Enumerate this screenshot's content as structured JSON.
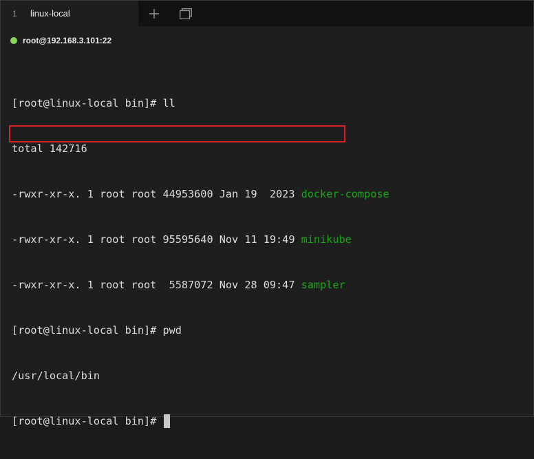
{
  "tab": {
    "index": "1",
    "title": "linux-local"
  },
  "session": {
    "label": "root@192.168.3.101:22",
    "status_color": "#8bd35a"
  },
  "terminal": {
    "lines": [
      {
        "text": "[root@linux-local bin]# ll",
        "name": ""
      },
      {
        "text": "total 142716",
        "name": ""
      },
      {
        "text": "-rwxr-xr-x. 1 root root 44953600 Jan 19  2023 ",
        "name": "docker-compose"
      },
      {
        "text": "-rwxr-xr-x. 1 root root 95595640 Nov 11 19:49 ",
        "name": "minikube"
      },
      {
        "text": "-rwxr-xr-x. 1 root root  5587072 Nov 28 09:47 ",
        "name": "sampler"
      },
      {
        "text": "[root@linux-local bin]# pwd",
        "name": ""
      },
      {
        "text": "/usr/local/bin",
        "name": ""
      },
      {
        "text": "[root@linux-local bin]# ",
        "name": ""
      }
    ]
  },
  "colors": {
    "executable": "#18a818",
    "highlight_border": "#d9242a",
    "background": "#1e1e1e"
  },
  "icons": {
    "new_tab": "plus-icon",
    "tab_overview": "window-icon"
  }
}
